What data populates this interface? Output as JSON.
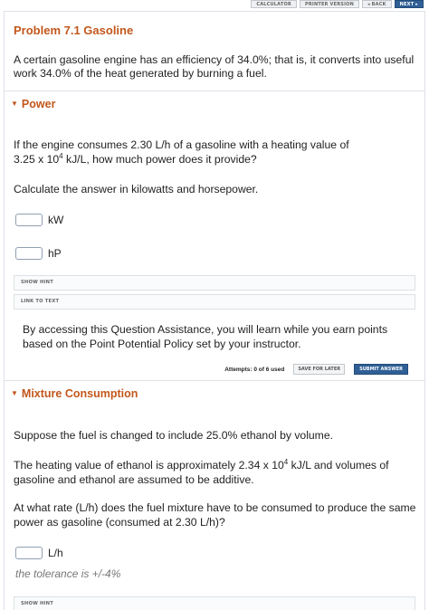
{
  "nav": {
    "calculator": "CALCULATOR",
    "printer": "PRINTER VERSION",
    "back": "◂ BACK",
    "next": "NEXT ▸"
  },
  "problem": {
    "title": "Problem 7.1 Gasoline",
    "intro": "A certain gasoline engine has an efficiency of 34.0%; that is, it converts into useful work 34.0% of the heat generated by burning a fuel."
  },
  "part1": {
    "title": "Power",
    "q1_a": "If the engine consumes 2.30 L/h of a gasoline with a heating value of",
    "q1_b_pre": "3.25 x 10",
    "q1_b_exp": "4",
    "q1_b_post": " kJ/L, how much power does it provide?",
    "q2": "Calculate the answer in kilowatts and horsepower.",
    "unit1": "kW",
    "unit2": "hP",
    "show_hint": "SHOW HINT",
    "link_to_text": "LINK TO TEXT",
    "assist": "By accessing this Question Assistance, you will learn while you earn points based on the Point Potential Policy set by your instructor.",
    "attempts": "Attempts: 0 of 6 used",
    "save_later": "SAVE FOR LATER",
    "submit": "SUBMIT ANSWER"
  },
  "part2": {
    "title": "Mixture Consumption",
    "q1": "Suppose the fuel is changed to include 25.0% ethanol by volume.",
    "q2_pre": "The heating value of ethanol is approximately 2.34 x 10",
    "q2_exp": "4",
    "q2_post": " kJ/L and volumes of gasoline and ethanol are assumed to be additive.",
    "q3": "At what rate (L/h) does the fuel mixture have to be consumed to produce the same power as gasoline (consumed at 2.30 L/h)?",
    "unit": "L/h",
    "tolerance": "the tolerance is +/-4%",
    "show_hint": "SHOW HINT"
  }
}
